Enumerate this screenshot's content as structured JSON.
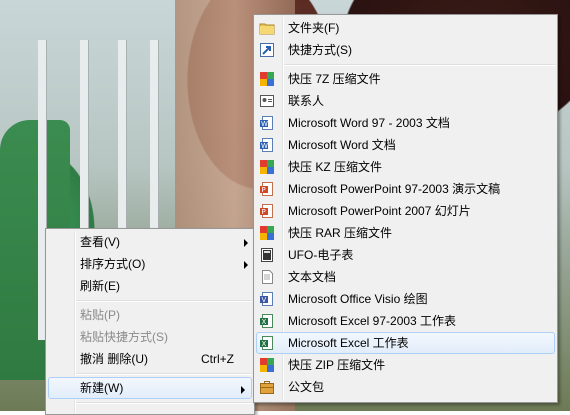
{
  "context_menu": {
    "items": [
      {
        "label": "查看(V)"
      },
      {
        "label": "排序方式(O)"
      },
      {
        "label": "刷新(E)"
      },
      {
        "label": "粘贴(P)"
      },
      {
        "label": "粘贴快捷方式(S)"
      },
      {
        "label": "撤消 删除(U)",
        "shortcut": "Ctrl+Z"
      },
      {
        "label": "新建(W)"
      }
    ]
  },
  "new_submenu": {
    "items": [
      {
        "label": "文件夹(F)",
        "icon": "folder-icon"
      },
      {
        "label": "快捷方式(S)",
        "icon": "shortcut-icon"
      },
      {
        "label": "快压 7Z 压缩文件",
        "icon": "archive-icon"
      },
      {
        "label": "联系人",
        "icon": "contact-icon"
      },
      {
        "label": "Microsoft Word 97 - 2003 文档",
        "icon": "word-icon"
      },
      {
        "label": "Microsoft Word 文档",
        "icon": "word-icon"
      },
      {
        "label": "快压 KZ 压缩文件",
        "icon": "archive-icon"
      },
      {
        "label": "Microsoft PowerPoint 97-2003 演示文稿",
        "icon": "powerpoint-icon"
      },
      {
        "label": "Microsoft PowerPoint 2007 幻灯片",
        "icon": "powerpoint-icon"
      },
      {
        "label": "快压 RAR 压缩文件",
        "icon": "archive-icon"
      },
      {
        "label": "UFO-电子表",
        "icon": "spreadsheet-icon"
      },
      {
        "label": "文本文档",
        "icon": "text-document-icon"
      },
      {
        "label": "Microsoft Office Visio 绘图",
        "icon": "visio-icon"
      },
      {
        "label": "Microsoft Excel 97-2003 工作表",
        "icon": "excel-icon"
      },
      {
        "label": "Microsoft Excel 工作表",
        "icon": "excel-icon"
      },
      {
        "label": "快压 ZIP 压缩文件",
        "icon": "archive-icon"
      },
      {
        "label": "公文包",
        "icon": "briefcase-icon"
      }
    ]
  }
}
